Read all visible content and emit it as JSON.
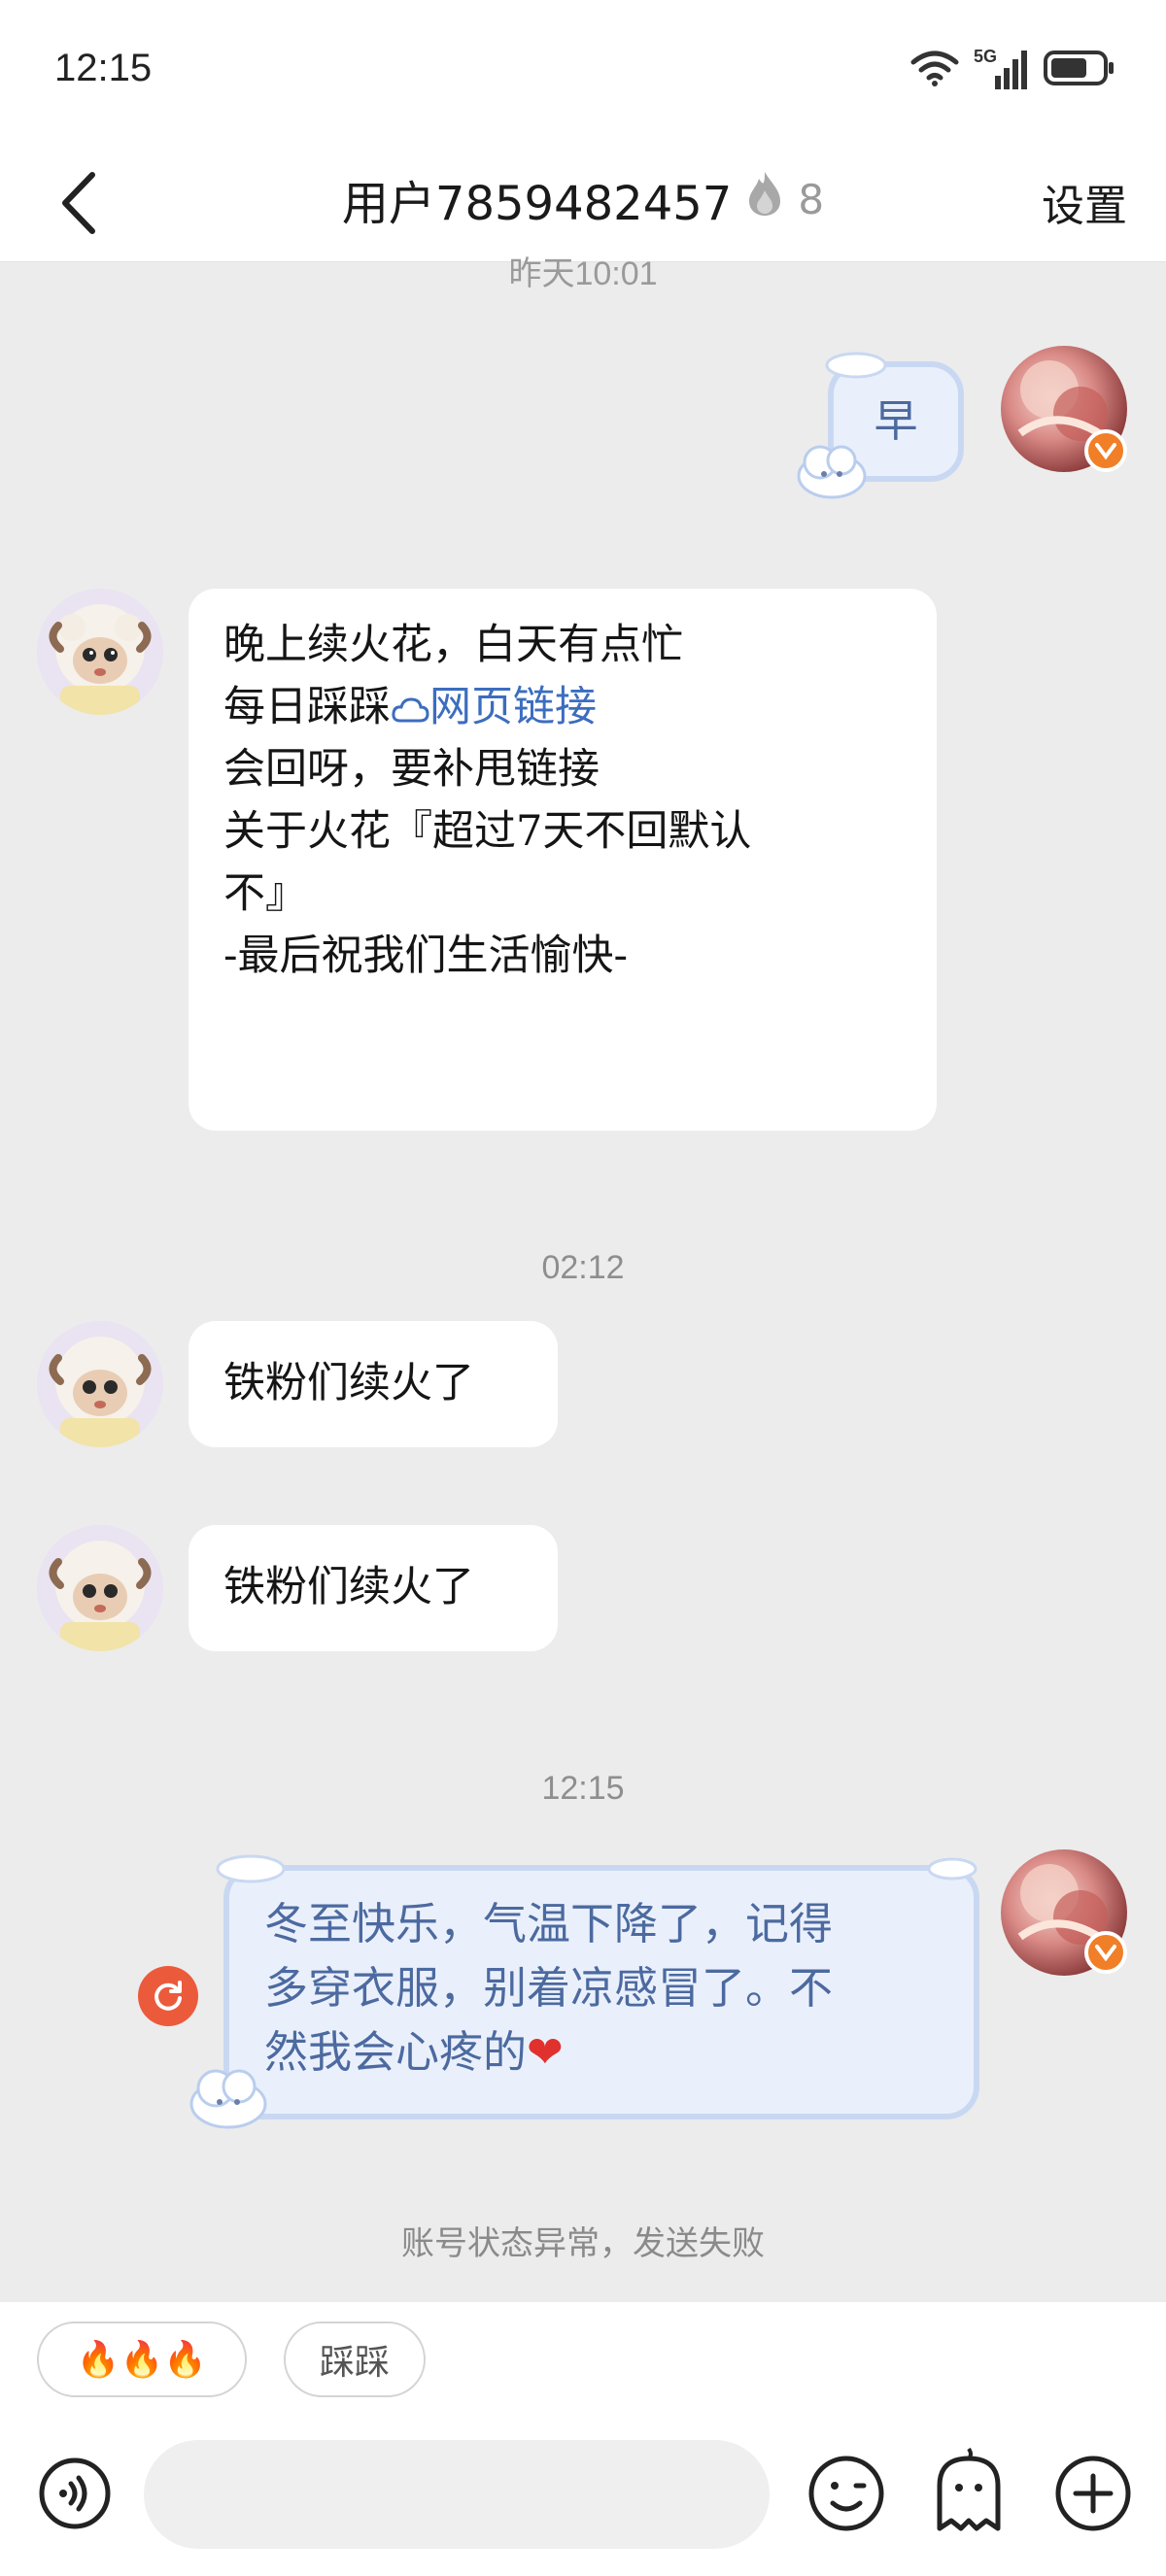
{
  "status_bar": {
    "time": "12:15",
    "network": "5G"
  },
  "header": {
    "title": "用户7859482457",
    "fire_count": "8",
    "settings_label": "设置"
  },
  "messages": {
    "top_timestamp": "昨天10:01",
    "m1": {
      "text": "早"
    },
    "m2": {
      "line1": "晚上续火花，白天有点忙",
      "line2_prefix": "每日踩踩",
      "line2_link": "网页链接",
      "line3": "会回呀，要补甩链接",
      "line4": "关于火花『超过7天不回默认",
      "line5": "不』",
      "line6": "-最后祝我们生活愉快-"
    },
    "ts2": "02:12",
    "m3": {
      "text": "铁粉们续火了"
    },
    "m4": {
      "text": "铁粉们续火了"
    },
    "ts3": "12:15",
    "m5": {
      "line1": "冬至快乐，气温下降了，记得",
      "line2": "多穿衣服，别着凉感冒了。不",
      "line3": "然我会心疼的",
      "emoji": "❤"
    },
    "send_failed": "账号状态异常，发送失败"
  },
  "quick_replies": {
    "fire_chip": "🔥🔥🔥",
    "cai_chip": "踩踩"
  },
  "colors": {
    "accent_blue": "#4c6aa0",
    "badge_orange": "#f07f28",
    "retry_red": "#ec5a3c"
  }
}
